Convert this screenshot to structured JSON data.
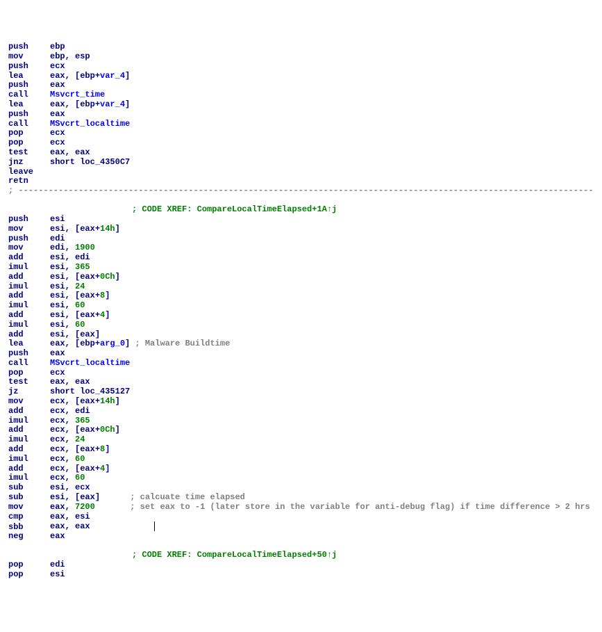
{
  "block1": [
    {
      "m": "push",
      "ops": [
        {
          "t": "reg",
          "v": "ebp"
        }
      ]
    },
    {
      "m": "mov",
      "ops": [
        {
          "t": "reg",
          "v": "ebp"
        },
        {
          "t": "punct",
          "v": ", "
        },
        {
          "t": "reg",
          "v": "esp"
        }
      ]
    },
    {
      "m": "push",
      "ops": [
        {
          "t": "reg",
          "v": "ecx"
        }
      ]
    },
    {
      "m": "lea",
      "ops": [
        {
          "t": "reg",
          "v": "eax"
        },
        {
          "t": "punct",
          "v": ", ["
        },
        {
          "t": "reg",
          "v": "ebp"
        },
        {
          "t": "punct",
          "v": "+"
        },
        {
          "t": "var",
          "v": "var_4"
        },
        {
          "t": "punct",
          "v": "]"
        }
      ]
    },
    {
      "m": "push",
      "ops": [
        {
          "t": "reg",
          "v": "eax"
        }
      ]
    },
    {
      "m": "call",
      "ops": [
        {
          "t": "fn",
          "v": "Msvcrt_time"
        }
      ]
    },
    {
      "m": "lea",
      "ops": [
        {
          "t": "reg",
          "v": "eax"
        },
        {
          "t": "punct",
          "v": ", ["
        },
        {
          "t": "reg",
          "v": "ebp"
        },
        {
          "t": "punct",
          "v": "+"
        },
        {
          "t": "var",
          "v": "var_4"
        },
        {
          "t": "punct",
          "v": "]"
        }
      ]
    },
    {
      "m": "push",
      "ops": [
        {
          "t": "reg",
          "v": "eax"
        }
      ]
    },
    {
      "m": "call",
      "ops": [
        {
          "t": "fn",
          "v": "MSvcrt_localtime"
        }
      ]
    },
    {
      "m": "pop",
      "ops": [
        {
          "t": "reg",
          "v": "ecx"
        }
      ]
    },
    {
      "m": "pop",
      "ops": [
        {
          "t": "reg",
          "v": "ecx"
        }
      ]
    },
    {
      "m": "test",
      "ops": [
        {
          "t": "reg",
          "v": "eax"
        },
        {
          "t": "punct",
          "v": ", "
        },
        {
          "t": "reg",
          "v": "eax"
        }
      ]
    },
    {
      "m": "jnz",
      "ops": [
        {
          "t": "reg",
          "v": "short "
        },
        {
          "t": "lbl",
          "v": "loc_4350C7"
        }
      ]
    },
    {
      "m": "leave",
      "ops": []
    },
    {
      "m": "retn",
      "ops": []
    }
  ],
  "xref1": "; CODE XREF: CompareLocalTimeElapsed+1A↑j",
  "block2": [
    {
      "m": "push",
      "ops": [
        {
          "t": "reg",
          "v": "esi"
        }
      ]
    },
    {
      "m": "mov",
      "ops": [
        {
          "t": "reg",
          "v": "esi"
        },
        {
          "t": "punct",
          "v": ", ["
        },
        {
          "t": "reg",
          "v": "eax"
        },
        {
          "t": "punct",
          "v": "+"
        },
        {
          "t": "num",
          "v": "14h"
        },
        {
          "t": "punct",
          "v": "]"
        }
      ]
    },
    {
      "m": "push",
      "ops": [
        {
          "t": "reg",
          "v": "edi"
        }
      ]
    },
    {
      "m": "mov",
      "ops": [
        {
          "t": "reg",
          "v": "edi"
        },
        {
          "t": "punct",
          "v": ", "
        },
        {
          "t": "num",
          "v": "1900"
        }
      ]
    },
    {
      "m": "add",
      "ops": [
        {
          "t": "reg",
          "v": "esi"
        },
        {
          "t": "punct",
          "v": ", "
        },
        {
          "t": "reg",
          "v": "edi"
        }
      ]
    },
    {
      "m": "imul",
      "ops": [
        {
          "t": "reg",
          "v": "esi"
        },
        {
          "t": "punct",
          "v": ", "
        },
        {
          "t": "num",
          "v": "365"
        }
      ]
    },
    {
      "m": "add",
      "ops": [
        {
          "t": "reg",
          "v": "esi"
        },
        {
          "t": "punct",
          "v": ", ["
        },
        {
          "t": "reg",
          "v": "eax"
        },
        {
          "t": "punct",
          "v": "+"
        },
        {
          "t": "num",
          "v": "0Ch"
        },
        {
          "t": "punct",
          "v": "]"
        }
      ]
    },
    {
      "m": "imul",
      "ops": [
        {
          "t": "reg",
          "v": "esi"
        },
        {
          "t": "punct",
          "v": ", "
        },
        {
          "t": "num",
          "v": "24"
        }
      ]
    },
    {
      "m": "add",
      "ops": [
        {
          "t": "reg",
          "v": "esi"
        },
        {
          "t": "punct",
          "v": ", ["
        },
        {
          "t": "reg",
          "v": "eax"
        },
        {
          "t": "punct",
          "v": "+"
        },
        {
          "t": "num",
          "v": "8"
        },
        {
          "t": "punct",
          "v": "]"
        }
      ]
    },
    {
      "m": "imul",
      "ops": [
        {
          "t": "reg",
          "v": "esi"
        },
        {
          "t": "punct",
          "v": ", "
        },
        {
          "t": "num",
          "v": "60"
        }
      ]
    },
    {
      "m": "add",
      "ops": [
        {
          "t": "reg",
          "v": "esi"
        },
        {
          "t": "punct",
          "v": ", ["
        },
        {
          "t": "reg",
          "v": "eax"
        },
        {
          "t": "punct",
          "v": "+"
        },
        {
          "t": "num",
          "v": "4"
        },
        {
          "t": "punct",
          "v": "]"
        }
      ]
    },
    {
      "m": "imul",
      "ops": [
        {
          "t": "reg",
          "v": "esi"
        },
        {
          "t": "punct",
          "v": ", "
        },
        {
          "t": "num",
          "v": "60"
        }
      ]
    },
    {
      "m": "add",
      "ops": [
        {
          "t": "reg",
          "v": "esi"
        },
        {
          "t": "punct",
          "v": ", ["
        },
        {
          "t": "reg",
          "v": "eax"
        },
        {
          "t": "punct",
          "v": "]"
        }
      ]
    },
    {
      "m": "lea",
      "ops": [
        {
          "t": "reg",
          "v": "eax"
        },
        {
          "t": "punct",
          "v": ", ["
        },
        {
          "t": "reg",
          "v": "ebp"
        },
        {
          "t": "punct",
          "v": "+"
        },
        {
          "t": "var",
          "v": "arg_0"
        },
        {
          "t": "punct",
          "v": "]"
        }
      ],
      "cmt": " ; Malware Buildtime"
    },
    {
      "m": "push",
      "ops": [
        {
          "t": "reg",
          "v": "eax"
        }
      ]
    },
    {
      "m": "call",
      "ops": [
        {
          "t": "fn",
          "v": "MSvcrt_localtime"
        }
      ]
    },
    {
      "m": "pop",
      "ops": [
        {
          "t": "reg",
          "v": "ecx"
        }
      ]
    },
    {
      "m": "test",
      "ops": [
        {
          "t": "reg",
          "v": "eax"
        },
        {
          "t": "punct",
          "v": ", "
        },
        {
          "t": "reg",
          "v": "eax"
        }
      ]
    },
    {
      "m": "jz",
      "ops": [
        {
          "t": "reg",
          "v": "short "
        },
        {
          "t": "lbl",
          "v": "loc_435127"
        }
      ]
    },
    {
      "m": "mov",
      "ops": [
        {
          "t": "reg",
          "v": "ecx"
        },
        {
          "t": "punct",
          "v": ", ["
        },
        {
          "t": "reg",
          "v": "eax"
        },
        {
          "t": "punct",
          "v": "+"
        },
        {
          "t": "num",
          "v": "14h"
        },
        {
          "t": "punct",
          "v": "]"
        }
      ]
    },
    {
      "m": "add",
      "ops": [
        {
          "t": "reg",
          "v": "ecx"
        },
        {
          "t": "punct",
          "v": ", "
        },
        {
          "t": "reg",
          "v": "edi"
        }
      ]
    },
    {
      "m": "imul",
      "ops": [
        {
          "t": "reg",
          "v": "ecx"
        },
        {
          "t": "punct",
          "v": ", "
        },
        {
          "t": "num",
          "v": "365"
        }
      ]
    },
    {
      "m": "add",
      "ops": [
        {
          "t": "reg",
          "v": "ecx"
        },
        {
          "t": "punct",
          "v": ", ["
        },
        {
          "t": "reg",
          "v": "eax"
        },
        {
          "t": "punct",
          "v": "+"
        },
        {
          "t": "num",
          "v": "0Ch"
        },
        {
          "t": "punct",
          "v": "]"
        }
      ]
    },
    {
      "m": "imul",
      "ops": [
        {
          "t": "reg",
          "v": "ecx"
        },
        {
          "t": "punct",
          "v": ", "
        },
        {
          "t": "num",
          "v": "24"
        }
      ]
    },
    {
      "m": "add",
      "ops": [
        {
          "t": "reg",
          "v": "ecx"
        },
        {
          "t": "punct",
          "v": ", ["
        },
        {
          "t": "reg",
          "v": "eax"
        },
        {
          "t": "punct",
          "v": "+"
        },
        {
          "t": "num",
          "v": "8"
        },
        {
          "t": "punct",
          "v": "]"
        }
      ]
    },
    {
      "m": "imul",
      "ops": [
        {
          "t": "reg",
          "v": "ecx"
        },
        {
          "t": "punct",
          "v": ", "
        },
        {
          "t": "num",
          "v": "60"
        }
      ]
    },
    {
      "m": "add",
      "ops": [
        {
          "t": "reg",
          "v": "ecx"
        },
        {
          "t": "punct",
          "v": ", ["
        },
        {
          "t": "reg",
          "v": "eax"
        },
        {
          "t": "punct",
          "v": "+"
        },
        {
          "t": "num",
          "v": "4"
        },
        {
          "t": "punct",
          "v": "]"
        }
      ]
    },
    {
      "m": "imul",
      "ops": [
        {
          "t": "reg",
          "v": "ecx"
        },
        {
          "t": "punct",
          "v": ", "
        },
        {
          "t": "num",
          "v": "60"
        }
      ]
    },
    {
      "m": "sub",
      "ops": [
        {
          "t": "reg",
          "v": "esi"
        },
        {
          "t": "punct",
          "v": ", "
        },
        {
          "t": "reg",
          "v": "ecx"
        }
      ]
    },
    {
      "m": "sub",
      "ops": [
        {
          "t": "reg",
          "v": "esi"
        },
        {
          "t": "punct",
          "v": ", ["
        },
        {
          "t": "reg",
          "v": "eax"
        },
        {
          "t": "punct",
          "v": "]"
        }
      ],
      "pad": "      ",
      "cmt": "; calcuate time elapsed"
    },
    {
      "m": "mov",
      "ops": [
        {
          "t": "reg",
          "v": "eax"
        },
        {
          "t": "punct",
          "v": ", "
        },
        {
          "t": "num",
          "v": "7200"
        }
      ],
      "pad": "       ",
      "cmt": "; set eax to -1 (later store in the variable for anti-debug flag) if time difference > 2 hrs"
    },
    {
      "m": "cmp",
      "ops": [
        {
          "t": "reg",
          "v": "eax"
        },
        {
          "t": "punct",
          "v": ", "
        },
        {
          "t": "reg",
          "v": "esi"
        }
      ]
    },
    {
      "m": "sbb",
      "ops": [
        {
          "t": "reg",
          "v": "eax"
        },
        {
          "t": "punct",
          "v": ", "
        },
        {
          "t": "reg",
          "v": "eax"
        }
      ],
      "cursor": true
    },
    {
      "m": "neg",
      "ops": [
        {
          "t": "reg",
          "v": "eax"
        }
      ]
    }
  ],
  "xref2": "; CODE XREF: CompareLocalTimeElapsed+50↑j",
  "block3": [
    {
      "m": "pop",
      "ops": [
        {
          "t": "reg",
          "v": "edi"
        }
      ]
    },
    {
      "m": "pop",
      "ops": [
        {
          "t": "reg",
          "v": "esi"
        }
      ]
    }
  ],
  "separator": "; ---------------------------------------------------------------------------------------------------------------------------"
}
